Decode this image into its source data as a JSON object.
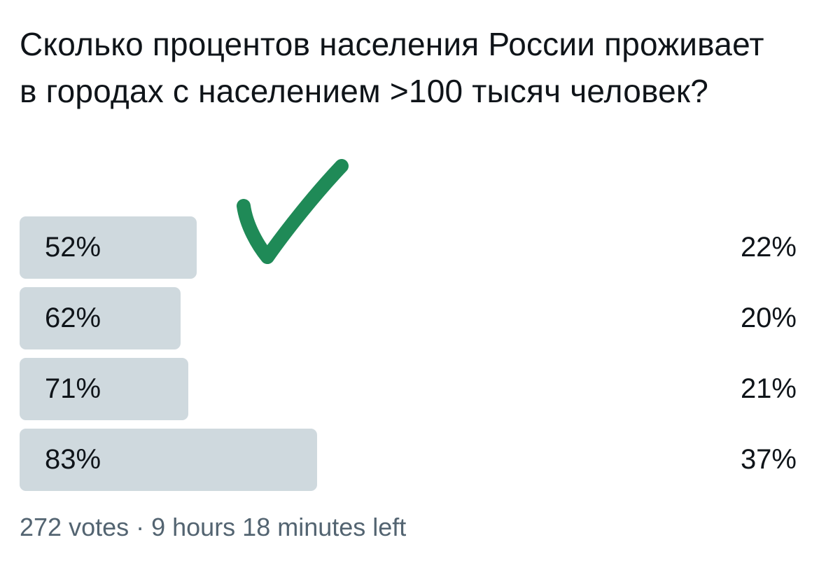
{
  "poll": {
    "question": "Сколько процентов населения России проживает в городах с населением >100 тысяч человек?",
    "options": [
      {
        "label": "52%",
        "percent": "22%",
        "share": 22
      },
      {
        "label": "62%",
        "percent": "20%",
        "share": 20
      },
      {
        "label": "71%",
        "percent": "21%",
        "share": 21
      },
      {
        "label": "83%",
        "percent": "37%",
        "share": 37
      }
    ],
    "footer": "272 votes · 9 hours 18 minutes left",
    "correct_option_index": 0
  },
  "colors": {
    "bar": "#cfd9de",
    "text": "#0f1419",
    "muted": "#536471",
    "checkmark": "#1f8a57"
  },
  "icons": {
    "checkmark": "check-icon"
  }
}
